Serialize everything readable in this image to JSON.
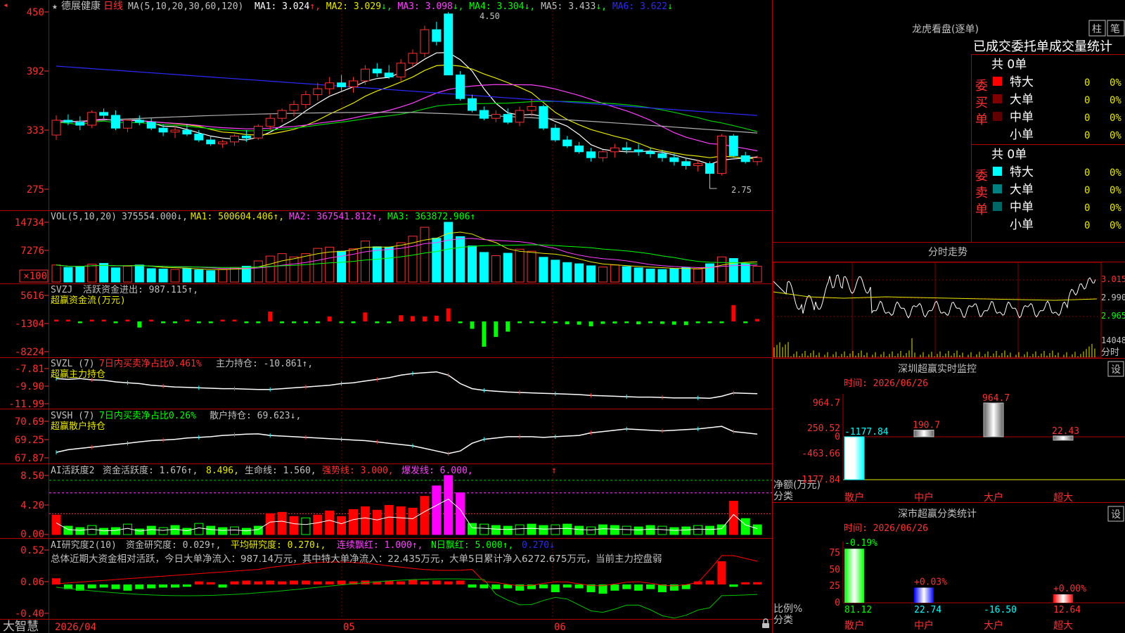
{
  "app": {
    "brand": "大智慧"
  },
  "header": {
    "star": "★",
    "name": "德展健康",
    "period": "日线",
    "ma_params": "MA(5,10,20,30,60,120)",
    "ma": [
      {
        "label": "MA1:",
        "value": "3.024",
        "arrow": "↑",
        "color": "#ffffff"
      },
      {
        "label": "MA2:",
        "value": "3.029",
        "arrow": "↓",
        "color": "#e8e800"
      },
      {
        "label": "MA3:",
        "value": "3.098",
        "arrow": "↓",
        "color": "#ff40ff"
      },
      {
        "label": "MA4:",
        "value": "3.304",
        "arrow": "↓",
        "color": "#00ff00"
      },
      {
        "label": "MA5:",
        "value": "3.433",
        "arrow": "↓",
        "color": "#c0c0c0"
      },
      {
        "label": "MA6:",
        "value": "3.622",
        "arrow": "↓",
        "color": "#2a2aff"
      }
    ],
    "high_marker": "4.50",
    "low_marker": "2.75"
  },
  "axes": {
    "price": [
      "450",
      "392",
      "333",
      "275"
    ],
    "vol": [
      "14734",
      "7276",
      "×100"
    ],
    "svzj": [
      "5616",
      "-1304",
      "-8224"
    ],
    "svzl": [
      "-7.81",
      "-9.90",
      "-11.99"
    ],
    "svsh": [
      "70.69",
      "69.25",
      "67.87"
    ],
    "act": [
      "8.50",
      "4.20",
      "0.00"
    ],
    "res": [
      "0.52",
      "0.06",
      "-0.40"
    ],
    "dates": [
      "2026/04",
      "05",
      "06"
    ]
  },
  "panels": {
    "vol": {
      "name": "VOL(5,10,20)",
      "value": "375554.000↓,",
      "ma": [
        {
          "text": "MA1: 500604.406↑,",
          "color": "#e8e800"
        },
        {
          "text": "MA2: 367541.812↑,",
          "color": "#ff40ff"
        },
        {
          "text": "MA3: 363872.906↑",
          "color": "#00ff00"
        }
      ]
    },
    "svzj": {
      "name": "SVZJ",
      "text": "活跃资金进出: 987.115↑,",
      "sub": "超赢资金流(万元)"
    },
    "svzl": {
      "name": "SVZL (7)",
      "ratio": "7日内买卖净占比0.461%",
      "text": "主力持仓: -10.861↑,",
      "sub": "超赢主力持仓"
    },
    "svsh": {
      "name": "SVSH (7)",
      "ratio": "7日内买卖净占比0.26%",
      "text": "散户持仓: 69.623↓,",
      "sub": "超赢散户持仓"
    },
    "act": {
      "name": "AI活跃度2",
      "text": "资金活跃度: 1.676↑,",
      "v2": "8.496,",
      "life": "生命线: 1.560,",
      "strong": "强势线: 3.000,",
      "burst": "爆发线: 6.000,"
    },
    "res": {
      "name": "AI研究度2(10)",
      "text": "资金研究度: 0.029↑,",
      "avg": "平均研究度: 0.270↓,",
      "cont": "连续飘红: 1.000↑,",
      "nday": "N日飘红: 5.000↑,",
      "v5": "0.270↓",
      "summary": "总体近期大资金相对活跃，今日大单净流入：987.14万元，其中特大单净流入：22.435万元，大单5日累计净入6272.675万元，当前主力控盘弱"
    }
  },
  "right": {
    "lhb_title": "龙虎看盘(逐单)",
    "btn_bar": "柱",
    "btn_pen": "笔",
    "order_title": "已成交委托单成交量统计",
    "buy": {
      "side": "委买单",
      "total": "共 0单",
      "rows": [
        {
          "label": "特大",
          "count": "0",
          "pct": "0%",
          "color": "#ff0000"
        },
        {
          "label": "大单",
          "count": "0",
          "pct": "0%",
          "color": "#800000"
        },
        {
          "label": "中单",
          "count": "0",
          "pct": "0%",
          "color": "#600000"
        },
        {
          "label": "小单",
          "count": "0",
          "pct": "0%",
          "color": ""
        }
      ]
    },
    "sell": {
      "side": "委卖单",
      "total": "共 0单",
      "rows": [
        {
          "label": "特大",
          "count": "0",
          "pct": "0%",
          "color": "#00ffff"
        },
        {
          "label": "大单",
          "count": "0",
          "pct": "0%",
          "color": "#008080"
        },
        {
          "label": "中单",
          "count": "0",
          "pct": "0%",
          "color": "#006666"
        },
        {
          "label": "小单",
          "count": "0",
          "pct": "0%",
          "color": ""
        }
      ]
    },
    "intraday": {
      "title": "分时走势",
      "p1": "3.015",
      "p2": "2.990",
      "p3": "2.965",
      "vol": "14048",
      "vol_label": "分时"
    },
    "monitor": {
      "title": "深圳超赢实时监控",
      "btn": "设",
      "time": "时间: 2026/06/26",
      "yticks": [
        "964.7",
        "250.52",
        "0",
        "-463.66",
        "-1177.84"
      ],
      "bars": [
        {
          "cat": "散户",
          "value": -1177.84,
          "label": "-1177.84",
          "label_color": "#00ffff"
        },
        {
          "cat": "中户",
          "value": 190.7,
          "label": "190.7",
          "label_color": "#ff3030"
        },
        {
          "cat": "大户",
          "value": 964.7,
          "label": "964.7",
          "label_color": "#ff3030"
        },
        {
          "cat": "超大",
          "value": 22.43,
          "label": "22.43",
          "label_color": "#ff3030"
        }
      ],
      "y_label1": "净额(万元)",
      "y_label2": "分类"
    },
    "classify": {
      "title": "深市超赢分类统计",
      "btn": "设",
      "time": "时间: 2026/06/26",
      "yticks": [
        "75",
        "50",
        "25",
        "0"
      ],
      "bars": [
        {
          "cat": "散户",
          "value": 81.12,
          "label": "81.12",
          "top": "-0.19%",
          "label_color": "#00ff00",
          "top_color": "#00ff00"
        },
        {
          "cat": "中户",
          "value": 22.74,
          "label": "22.74",
          "top": "+0.03%",
          "label_color": "#00ffff",
          "top_color": "#ff3030"
        },
        {
          "cat": "大户",
          "value": -16.5,
          "label": "-16.50",
          "top": "",
          "label_color": "#00ffff",
          "top_color": "#ff3030"
        },
        {
          "cat": "超大",
          "value": 12.64,
          "label": "12.64",
          "top": "+0.00%",
          "label_color": "#ff3030",
          "top_color": "#ff3030"
        }
      ],
      "y_label1": "比例%",
      "y_label2": "分类"
    }
  },
  "chart_data": [
    {
      "type": "candlestick",
      "title": "德展健康 日线",
      "ylim": [
        2.75,
        4.5
      ],
      "ohlc": [
        [
          3.25,
          3.45,
          3.2,
          3.4
        ],
        [
          3.4,
          3.46,
          3.35,
          3.38
        ],
        [
          3.38,
          3.44,
          3.3,
          3.35
        ],
        [
          3.35,
          3.5,
          3.32,
          3.48
        ],
        [
          3.48,
          3.52,
          3.42,
          3.45
        ],
        [
          3.45,
          3.5,
          3.3,
          3.32
        ],
        [
          3.32,
          3.42,
          3.28,
          3.4
        ],
        [
          3.4,
          3.45,
          3.35,
          3.38
        ],
        [
          3.38,
          3.42,
          3.3,
          3.32
        ],
        [
          3.32,
          3.36,
          3.24,
          3.28
        ],
        [
          3.28,
          3.34,
          3.22,
          3.3
        ],
        [
          3.3,
          3.36,
          3.24,
          3.26
        ],
        [
          3.26,
          3.3,
          3.18,
          3.2
        ],
        [
          3.2,
          3.24,
          3.14,
          3.16
        ],
        [
          3.16,
          3.2,
          3.12,
          3.18
        ],
        [
          3.18,
          3.26,
          3.14,
          3.24
        ],
        [
          3.24,
          3.3,
          3.18,
          3.22
        ],
        [
          3.22,
          3.36,
          3.2,
          3.34
        ],
        [
          3.34,
          3.46,
          3.3,
          3.42
        ],
        [
          3.42,
          3.52,
          3.38,
          3.5
        ],
        [
          3.5,
          3.6,
          3.44,
          3.56
        ],
        [
          3.56,
          3.7,
          3.52,
          3.66
        ],
        [
          3.66,
          3.78,
          3.6,
          3.72
        ],
        [
          3.72,
          3.84,
          3.66,
          3.78
        ],
        [
          3.78,
          3.86,
          3.7,
          3.74
        ],
        [
          3.74,
          3.84,
          3.68,
          3.8
        ],
        [
          3.8,
          3.96,
          3.76,
          3.92
        ],
        [
          3.92,
          3.98,
          3.84,
          3.88
        ],
        [
          3.88,
          3.96,
          3.82,
          3.84
        ],
        [
          3.84,
          4.02,
          3.8,
          3.98
        ],
        [
          3.98,
          4.12,
          3.94,
          4.08
        ],
        [
          4.08,
          4.36,
          4.04,
          4.32
        ],
        [
          4.32,
          4.4,
          4.16,
          4.2
        ],
        [
          4.48,
          4.5,
          3.86,
          3.86
        ],
        [
          3.86,
          3.9,
          3.6,
          3.62
        ],
        [
          3.62,
          3.66,
          3.48,
          3.5
        ],
        [
          3.5,
          3.54,
          3.4,
          3.42
        ],
        [
          3.42,
          3.5,
          3.38,
          3.46
        ],
        [
          3.46,
          3.52,
          3.36,
          3.38
        ],
        [
          3.38,
          3.54,
          3.34,
          3.5
        ],
        [
          3.5,
          3.62,
          3.44,
          3.54
        ],
        [
          3.54,
          3.56,
          3.3,
          3.32
        ],
        [
          3.32,
          3.36,
          3.18,
          3.2
        ],
        [
          3.2,
          3.24,
          3.12,
          3.14
        ],
        [
          3.14,
          3.18,
          3.06,
          3.08
        ],
        [
          3.08,
          3.12,
          2.98,
          3.02
        ],
        [
          3.02,
          3.1,
          2.98,
          3.08
        ],
        [
          3.08,
          3.16,
          3.02,
          3.12
        ],
        [
          3.12,
          3.18,
          3.06,
          3.1
        ],
        [
          3.1,
          3.16,
          3.04,
          3.08
        ],
        [
          3.08,
          3.12,
          3.02,
          3.06
        ],
        [
          3.06,
          3.1,
          2.98,
          3.02
        ],
        [
          3.02,
          3.06,
          2.94,
          2.98
        ],
        [
          2.98,
          3.02,
          2.9,
          2.94
        ],
        [
          2.94,
          3.0,
          2.88,
          2.96
        ],
        [
          2.96,
          2.98,
          2.75,
          2.86
        ],
        [
          2.86,
          3.26,
          2.84,
          3.24
        ],
        [
          3.24,
          3.26,
          3.02,
          3.04
        ],
        [
          3.04,
          3.08,
          2.96,
          2.98
        ],
        [
          2.98,
          3.04,
          2.94,
          3.02
        ]
      ]
    },
    {
      "type": "bar",
      "title": "VOL",
      "ylim": [
        0,
        14734
      ],
      "values": [
        4200,
        3600,
        3800,
        4400,
        4600,
        3500,
        3900,
        4200,
        3300,
        3200,
        3100,
        3400,
        3000,
        2800,
        3100,
        3600,
        3900,
        5200,
        6400,
        7000,
        6200,
        7000,
        8300,
        8600,
        7600,
        8200,
        10100,
        8700,
        8600,
        9700,
        11300,
        13500,
        10800,
        14734,
        11200,
        8900,
        7300,
        6500,
        7100,
        8100,
        7600,
        6100,
        5400,
        4800,
        4500,
        4000,
        3700,
        4200,
        3800,
        3500,
        3200,
        3100,
        3300,
        3600,
        3200,
        4500,
        6200,
        5800,
        4600,
        3900
      ]
    },
    {
      "type": "bar",
      "title": "超赢资金流(万元)",
      "ylim": [
        -8224,
        5616
      ],
      "values": [
        200,
        150,
        -200,
        100,
        150,
        -180,
        90,
        -1500,
        100,
        -200,
        -150,
        120,
        -180,
        -220,
        150,
        100,
        -160,
        -200,
        2400,
        -120,
        -150,
        -180,
        -220,
        1200,
        -160,
        -120,
        2200,
        -220,
        -140,
        1500,
        1300,
        1200,
        1400,
        3200,
        -260,
        -1800,
        -6200,
        -3800,
        -2500,
        -180,
        -240,
        -150,
        -300,
        -700,
        -800,
        -1200,
        -600,
        -500,
        -300,
        -700,
        -400,
        -600,
        -800,
        -900,
        -250,
        -180,
        -400,
        4000,
        -300,
        600,
        500
      ]
    },
    {
      "type": "line",
      "title": "超赢主力持仓",
      "ylim": [
        -11.99,
        -7.81
      ],
      "values": [
        -9.0,
        -9.1,
        -9.0,
        -9.15,
        -9.2,
        -9.4,
        -9.5,
        -9.6,
        -9.8,
        -9.9,
        -10.0,
        -10.05,
        -10.1,
        -10.15,
        -10.2,
        -10.2,
        -10.25,
        -10.3,
        -10.3,
        -10.2,
        -10.1,
        -10.0,
        -9.9,
        -9.8,
        -9.6,
        -9.5,
        -9.3,
        -9.1,
        -8.9,
        -8.6,
        -8.4,
        -8.3,
        -8.2,
        -8.6,
        -9.6,
        -10.2,
        -10.4,
        -10.5,
        -10.6,
        -10.65,
        -10.7,
        -10.75,
        -10.8,
        -10.85,
        -10.9,
        -11.0,
        -11.05,
        -11.1,
        -11.15,
        -11.2,
        -11.2,
        -11.25,
        -11.3,
        -11.3,
        -11.3,
        -11.35,
        -11.1,
        -10.7,
        -10.75,
        -10.8,
        -10.86
      ]
    },
    {
      "type": "line",
      "title": "超赢散户持仓",
      "ylim": [
        67.87,
        70.69
      ],
      "values": [
        68.3,
        68.5,
        68.6,
        68.7,
        68.8,
        68.9,
        69.0,
        69.1,
        69.2,
        69.25,
        69.3,
        69.4,
        69.45,
        69.5,
        69.6,
        69.65,
        69.7,
        69.72,
        69.6,
        69.55,
        69.5,
        69.45,
        69.4,
        69.35,
        69.3,
        69.25,
        69.2,
        69.1,
        69.0,
        68.9,
        68.8,
        68.6,
        68.4,
        68.2,
        68.4,
        69.0,
        69.3,
        69.4,
        69.5,
        69.5,
        69.5,
        69.45,
        69.5,
        69.55,
        69.6,
        69.8,
        69.9,
        70.0,
        70.1,
        70.05,
        70.0,
        69.95,
        70.0,
        70.05,
        70.1,
        70.2,
        70.3,
        69.9,
        69.8,
        69.7,
        69.62
      ]
    },
    {
      "type": "bar",
      "title": "AI活跃度2",
      "ylim": [
        0,
        8.5
      ],
      "values": [
        2.8,
        1.2,
        1.0,
        1.3,
        0.9,
        1.0,
        1.5,
        0.8,
        1.2,
        1.0,
        1.3,
        0.9,
        1.6,
        1.2,
        1.0,
        1.1,
        0.9,
        1.2,
        3.0,
        3.2,
        2.6,
        2.4,
        2.8,
        3.4,
        2.6,
        3.6,
        4.0,
        3.5,
        4.2,
        4.0,
        3.8,
        5.5,
        7.0,
        8.5,
        6.0,
        1.6,
        1.5,
        1.3,
        1.2,
        1.4,
        1.5,
        1.3,
        1.4,
        1.5,
        1.2,
        1.1,
        1.4,
        1.3,
        1.2,
        1.1,
        1.3,
        1.2,
        1.0,
        1.1,
        1.3,
        1.2,
        1.4,
        4.8,
        2.3,
        1.4,
        1.676
      ]
    },
    {
      "type": "bar",
      "title": "AI研究度2(10)",
      "ylim": [
        -0.4,
        0.52
      ],
      "values": [
        0.08,
        -0.06,
        -0.08,
        -0.05,
        -0.04,
        -0.06,
        -0.08,
        -0.06,
        -0.05,
        -0.04,
        -0.04,
        -0.03,
        0.04,
        0.03,
        -0.04,
        0.04,
        0.05,
        0.04,
        0.05,
        0.04,
        0.05,
        0.05,
        0.04,
        0.04,
        0.05,
        0.04,
        0.05,
        0.04,
        0.05,
        0.04,
        0.06,
        0.04,
        0.05,
        0.04,
        0.05,
        -0.04,
        -0.05,
        -0.06,
        -0.05,
        -0.08,
        -0.06,
        -0.05,
        -0.1,
        -0.04,
        -0.05,
        -0.1,
        -0.12,
        -0.08,
        -0.06,
        -0.08,
        -0.06,
        -0.1,
        -0.08,
        -0.06,
        0.04,
        0.05,
        0.3,
        -0.03,
        0.029,
        0.03,
        0.02
      ]
    },
    {
      "type": "bar",
      "title": "深圳超赢实时监控",
      "ylim": [
        -1177.84,
        964.7
      ],
      "categories": [
        "散户",
        "中户",
        "大户",
        "超大"
      ],
      "values": [
        -1177.84,
        190.7,
        964.7,
        22.43
      ]
    },
    {
      "type": "bar",
      "title": "深市超赢分类统计",
      "ylim": [
        0,
        75
      ],
      "categories": [
        "散户",
        "中户",
        "大户",
        "超大"
      ],
      "values": [
        81.12,
        22.74,
        -16.5,
        12.64
      ]
    }
  ]
}
